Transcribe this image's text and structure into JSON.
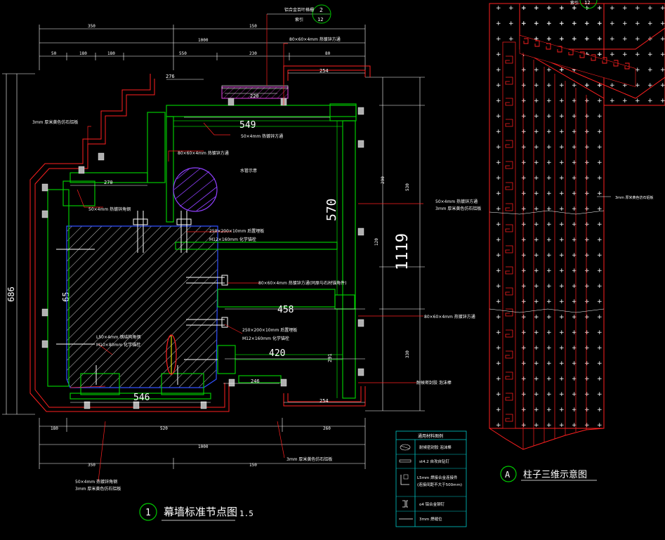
{
  "title_main": "幕墙标准节点图",
  "title_main_num": "1",
  "title_main_scale": "1.5",
  "title_side": "柱子三维示意图",
  "title_side_letter": "A",
  "ref_top": {
    "text": "铝合金百叶格栅",
    "num": "2",
    "sheet": "12",
    "label2": "索引"
  },
  "ref_side_sheet": "12",
  "ref_side_label": "索引",
  "dims_top": [
    "350",
    "150",
    "1000",
    "50",
    "180",
    "180",
    "550",
    "230",
    "80"
  ],
  "dims_bottom": [
    "180",
    "520",
    "260",
    "1000",
    "350",
    "150"
  ],
  "dims_left": [
    "686",
    "65"
  ],
  "dims_right": [
    "1119",
    "570",
    "120",
    "530",
    "290",
    "330"
  ],
  "dims_inner": [
    "276",
    "220",
    "254",
    "549",
    "270",
    "458",
    "420",
    "291",
    "246",
    "254",
    "546"
  ],
  "notes": {
    "n_tube1": "80×60×4mm  热镀锌方通",
    "n_stone_left": "3mm 厚米黄色仿石铝板",
    "n_tube2": "50×4mm  热镀锌方通",
    "n_tube3": "80×60×4mm  热镀锌方通",
    "n_pipe": "水管示意",
    "n_angle": "50×4mm  热镀锌角钢",
    "n_plate1": "250×200×10mm  后置埋板",
    "n_bolt1": "M12×160mm  化学锚栓",
    "n_tube4": "80×60×4mm  热镀锌方通(同原与石材锚角件)",
    "n_right1": "50×4mm  热镀锌方通",
    "n_right2": "3mm 厚米黄色仿石铝板",
    "n_right3": "80×60×4mm  热镀锌方通",
    "n_angle2": "L50×4mm  钢结构角钢",
    "n_bolt2": "M10×80mm  化学锚栓",
    "n_plate2": "250×200×10mm  后置埋板",
    "n_bolt3": "M12×160mm  化学锚栓",
    "n_seal": "耐候密封胶 泡沫棒",
    "n_bottom1": "3mm  厚米黄色仿石铝板",
    "n_bottom2": "50×4mm  热镀锌角钢",
    "n_bottom3": "3mm  厚米黄色仿石铝板",
    "n_3d": "3mm 厚米黄色仿石铝板"
  },
  "legend": {
    "title": "通用材料图例",
    "rows": [
      {
        "icon": "foam-rod-icon",
        "text": "耐候密封胶 泡沫棒"
      },
      {
        "icon": "bolt-icon",
        "text": "st4.2 自攻自钻钉"
      },
      {
        "icon": "angle-icon",
        "text": "L5mm  焊接合金连接件"
      },
      {
        "icon": "angle-icon-note",
        "text": "(连接间距不大于500mm)"
      },
      {
        "icon": "rivet-icon",
        "text": "o4 铝合金铆钉"
      },
      {
        "icon": "line-icon",
        "text": "3mm   焊缝位"
      }
    ]
  },
  "colors": {
    "cad_green": "#00c800",
    "cad_red": "#ff2020",
    "cad_white": "#ffffff",
    "cad_blue": "#3050ff",
    "cad_cyan": "#00c8c8",
    "cad_magenta": "#e040e0",
    "cad_yellow": "#ffff00"
  }
}
